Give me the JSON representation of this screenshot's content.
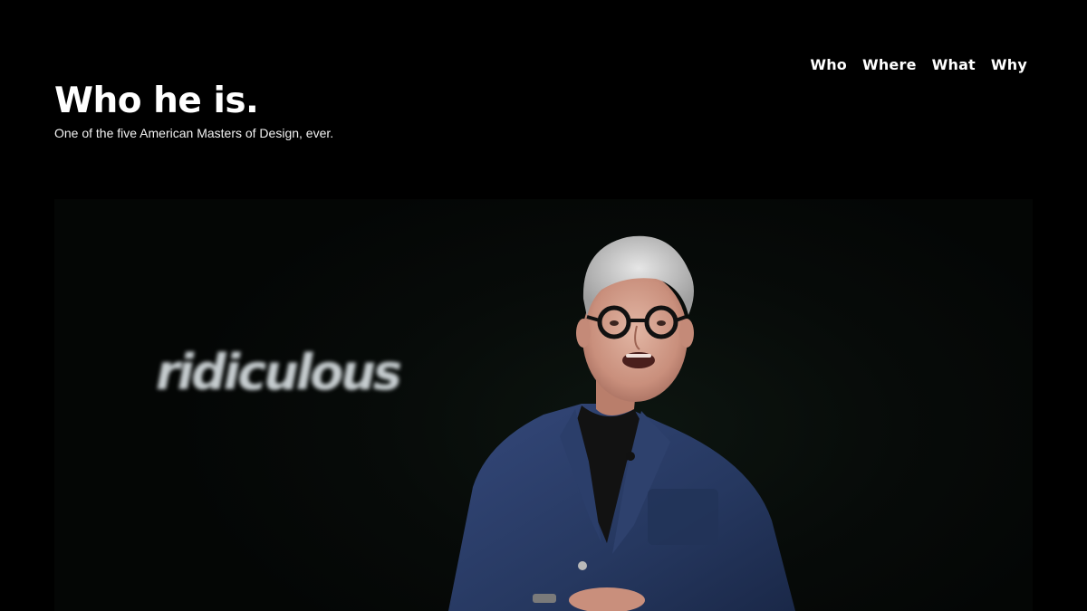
{
  "nav": {
    "items": [
      {
        "label": "Who"
      },
      {
        "label": "Where"
      },
      {
        "label": "What"
      },
      {
        "label": "Why"
      }
    ]
  },
  "hero": {
    "title": "Who he is.",
    "subtitle": "One of the five American Masters of Design, ever."
  },
  "photo": {
    "slide_word": "ridiculous"
  },
  "colors": {
    "background": "#000000",
    "text": "#ffffff",
    "jacket": "#283a5c"
  }
}
